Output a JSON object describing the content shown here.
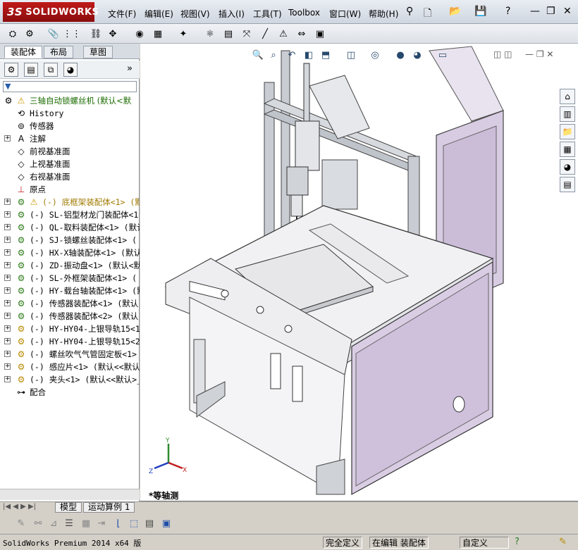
{
  "app": {
    "logo_prefix": "3S",
    "logo_name": "SOLIDWORKS"
  },
  "menu": [
    "文件(F)",
    "编辑(E)",
    "视图(V)",
    "插入(I)",
    "工具(T)",
    "Toolbox",
    "窗口(W)",
    "帮助(H)"
  ],
  "panel_tabs": [
    "装配体",
    "布局",
    "草图"
  ],
  "feature_tree": {
    "root": "三轴自动锁螺丝机  (默认<默",
    "items": [
      {
        "label": "History",
        "icon": "history-icon",
        "expand": false
      },
      {
        "label": "传感器",
        "icon": "sensor-icon",
        "expand": false
      },
      {
        "label": "注解",
        "icon": "annotation-icon",
        "expand": true
      },
      {
        "label": "前视基准面",
        "icon": "plane-icon",
        "expand": false
      },
      {
        "label": "上视基准面",
        "icon": "plane-icon",
        "expand": false
      },
      {
        "label": "右视基准面",
        "icon": "plane-icon",
        "expand": false
      },
      {
        "label": "原点",
        "icon": "origin-icon",
        "expand": false
      },
      {
        "label": "(-) 底框架装配体<1> (默",
        "icon": "assembly-warning-icon",
        "expand": true
      },
      {
        "label": "(-) SL-铝型材龙门装配体<1",
        "icon": "assembly-icon",
        "expand": true
      },
      {
        "label": "(-) QL-取料装配体<1> (默认",
        "icon": "assembly-icon",
        "expand": true
      },
      {
        "label": "(-) SJ-锁螺丝装配体<1> (",
        "icon": "assembly-icon",
        "expand": true
      },
      {
        "label": "(-) HX-X轴装配体<1> (默认",
        "icon": "assembly-icon",
        "expand": true
      },
      {
        "label": "(-) ZD-振动盘<1> (默认<默",
        "icon": "assembly-icon",
        "expand": true
      },
      {
        "label": "(-) SL-外框架装配体<1> (",
        "icon": "assembly-icon",
        "expand": true
      },
      {
        "label": "(-) HY-载台轴装配体<1> (默",
        "icon": "assembly-icon",
        "expand": true
      },
      {
        "label": "(-) 传感器装配体<1> (默认",
        "icon": "assembly-icon",
        "expand": true
      },
      {
        "label": "(-) 传感器装配体<2> (默认",
        "icon": "assembly-icon",
        "expand": true
      },
      {
        "label": "(-) HY-HY04-上银导轨15<1>",
        "icon": "part-icon",
        "expand": true
      },
      {
        "label": "(-) HY-HY04-上银导轨15<2>",
        "icon": "part-icon",
        "expand": true
      },
      {
        "label": "(-) 螺丝吹气气管固定板<1>",
        "icon": "part-icon",
        "expand": true
      },
      {
        "label": "(-) 感应片<1> (默认<<默认>",
        "icon": "part-icon",
        "expand": true
      },
      {
        "label": "(-) 夹头<1> (默认<<默认>_显",
        "icon": "part-icon",
        "expand": true
      },
      {
        "label": "配合",
        "icon": "mates-icon",
        "expand": false
      }
    ]
  },
  "bottom_tabs": [
    "模型",
    "运动算例 1"
  ],
  "view_label": "*等轴测",
  "status": {
    "product": "SolidWorks Premium 2014 x64 版",
    "cells": [
      "完全定义",
      "在编辑 装配体",
      "自定义"
    ]
  },
  "colors": {
    "accent": "#b71c1c",
    "panel": "#d4d0c8",
    "sheet": "#e4dcec",
    "frame": "#9aa0a8"
  }
}
